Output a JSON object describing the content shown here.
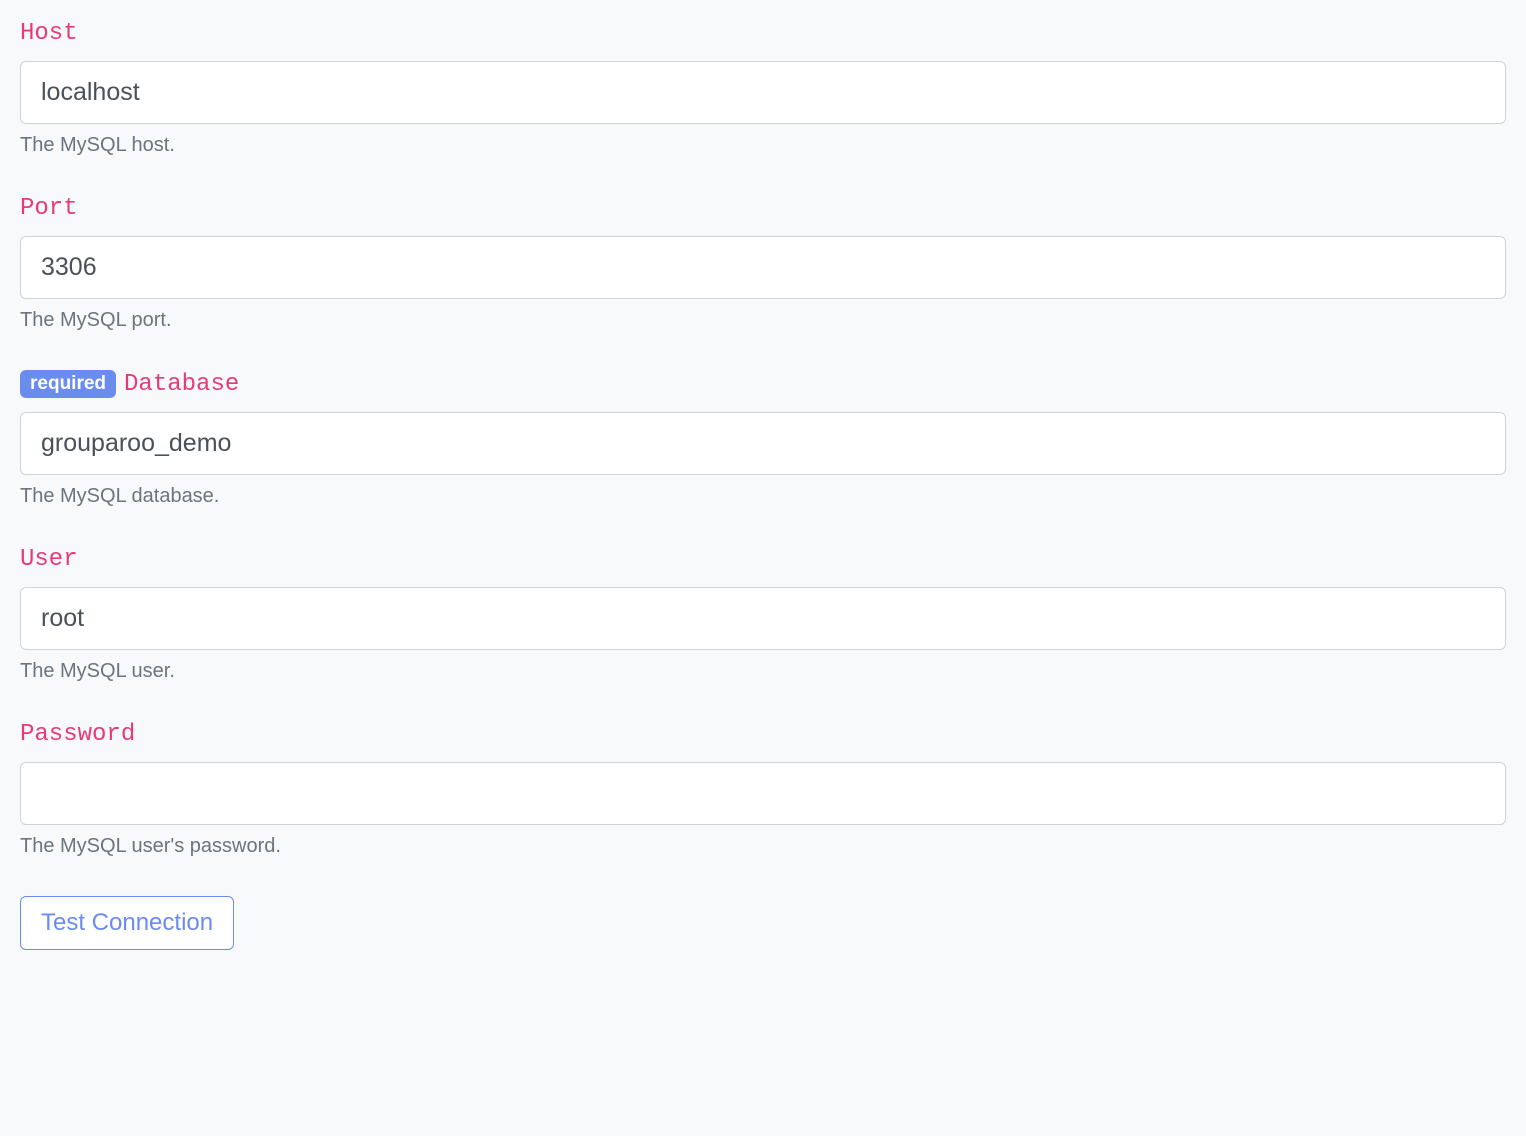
{
  "fields": {
    "host": {
      "label": "Host",
      "value": "localhost",
      "help": "The MySQL host."
    },
    "port": {
      "label": "Port",
      "value": "3306",
      "help": "The MySQL port."
    },
    "database": {
      "label": "Database",
      "badge": "required",
      "value": "grouparoo_demo",
      "help": "The MySQL database."
    },
    "user": {
      "label": "User",
      "value": "root",
      "help": "The MySQL user."
    },
    "password": {
      "label": "Password",
      "value": "",
      "help": "The MySQL user's password."
    }
  },
  "actions": {
    "test_connection": "Test Connection"
  }
}
